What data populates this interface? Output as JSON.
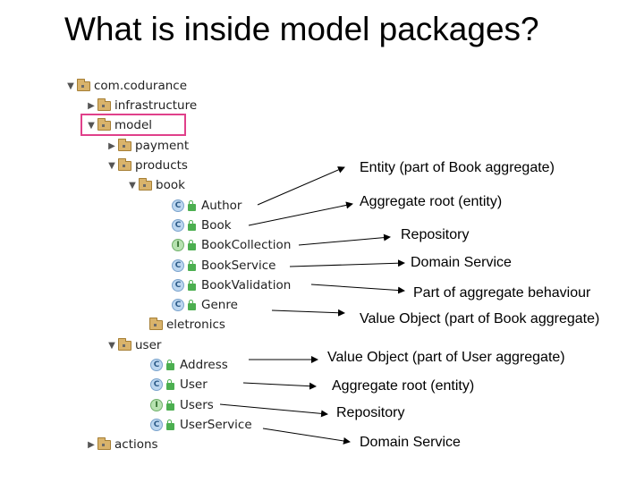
{
  "title": "What is inside model packages?",
  "tree": {
    "root": "com.codurance",
    "infrastructure": "infrastructure",
    "model": "model",
    "payment": "payment",
    "products": "products",
    "book": "book",
    "author": "Author",
    "book_class": "Book",
    "book_collection": "BookCollection",
    "book_service": "BookService",
    "book_validation": "BookValidation",
    "genre": "Genre",
    "eletronics": "eletronics",
    "user_pkg": "user",
    "address": "Address",
    "user_class": "User",
    "users": "Users",
    "user_service": "UserService",
    "actions": "actions"
  },
  "icons": {
    "class_badge": "C",
    "interface_badge": "I"
  },
  "annotations": {
    "author": "Entity (part of Book aggregate)",
    "book": "Aggregate root (entity)",
    "book_collection": "Repository",
    "book_service": "Domain Service",
    "book_validation": "Part of aggregate behaviour",
    "genre": "Value Object (part of Book aggregate)",
    "address": "Value Object (part of User aggregate)",
    "user": "Aggregate root (entity)",
    "users": "Repository",
    "user_service": "Domain Service"
  },
  "colors": {
    "highlight": "#e0408a",
    "folder": "#d9b36b",
    "class_icon": "#bcd6ef",
    "interface_icon": "#b7e2b0"
  }
}
